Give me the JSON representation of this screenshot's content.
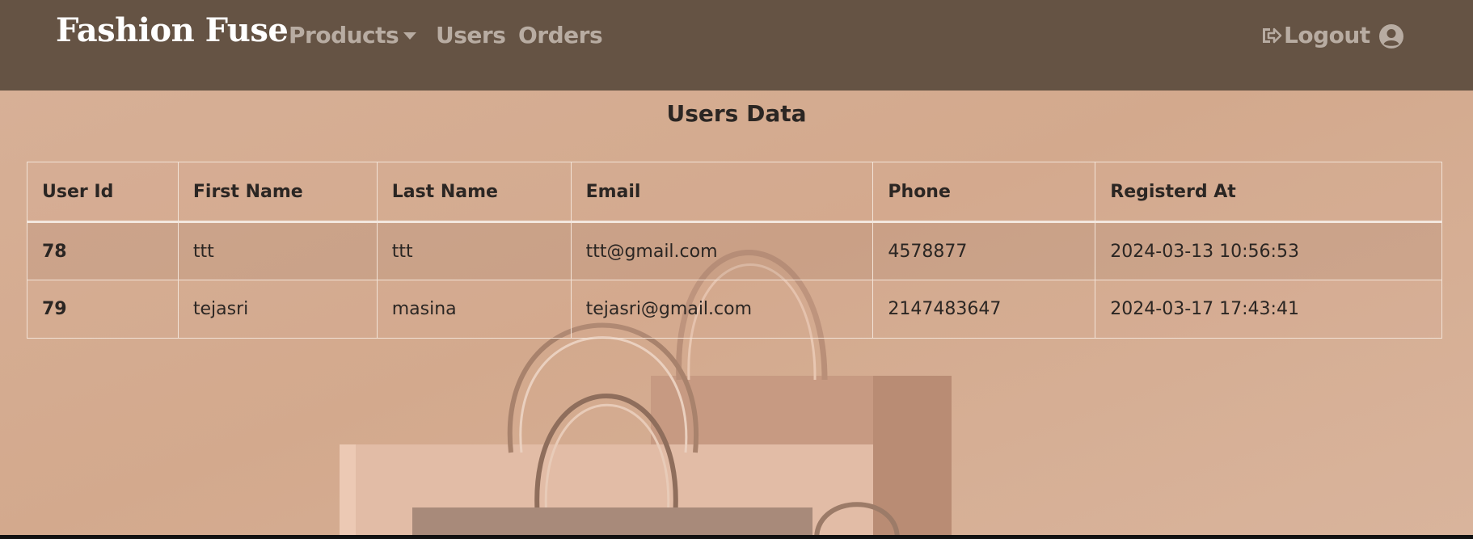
{
  "nav": {
    "brand": "Fashion Fuse",
    "products_label": "Products",
    "users_label": "Users",
    "orders_label": "Orders",
    "logout_label": "Logout",
    "icons": {
      "dropdown": "caret-down-icon",
      "logout": "logout-icon",
      "profile": "user-circle-icon"
    }
  },
  "page": {
    "title": "Users Data"
  },
  "table": {
    "headers": [
      "User Id",
      "First Name",
      "Last Name",
      "Email",
      "Phone",
      "Registerd At"
    ],
    "rows": [
      [
        "78",
        "ttt",
        "ttt",
        "ttt@gmail.com",
        "4578877",
        "2024-03-13 10:56:53"
      ],
      [
        "79",
        "tejasri",
        "masina",
        "tejasri@gmail.com",
        "2147483647",
        "2024-03-17 17:43:41"
      ]
    ]
  },
  "colors": {
    "navbar": "#655344",
    "background": "#d6ae93",
    "nav_text": "#b8aca2",
    "brand_text": "#ffffff"
  }
}
